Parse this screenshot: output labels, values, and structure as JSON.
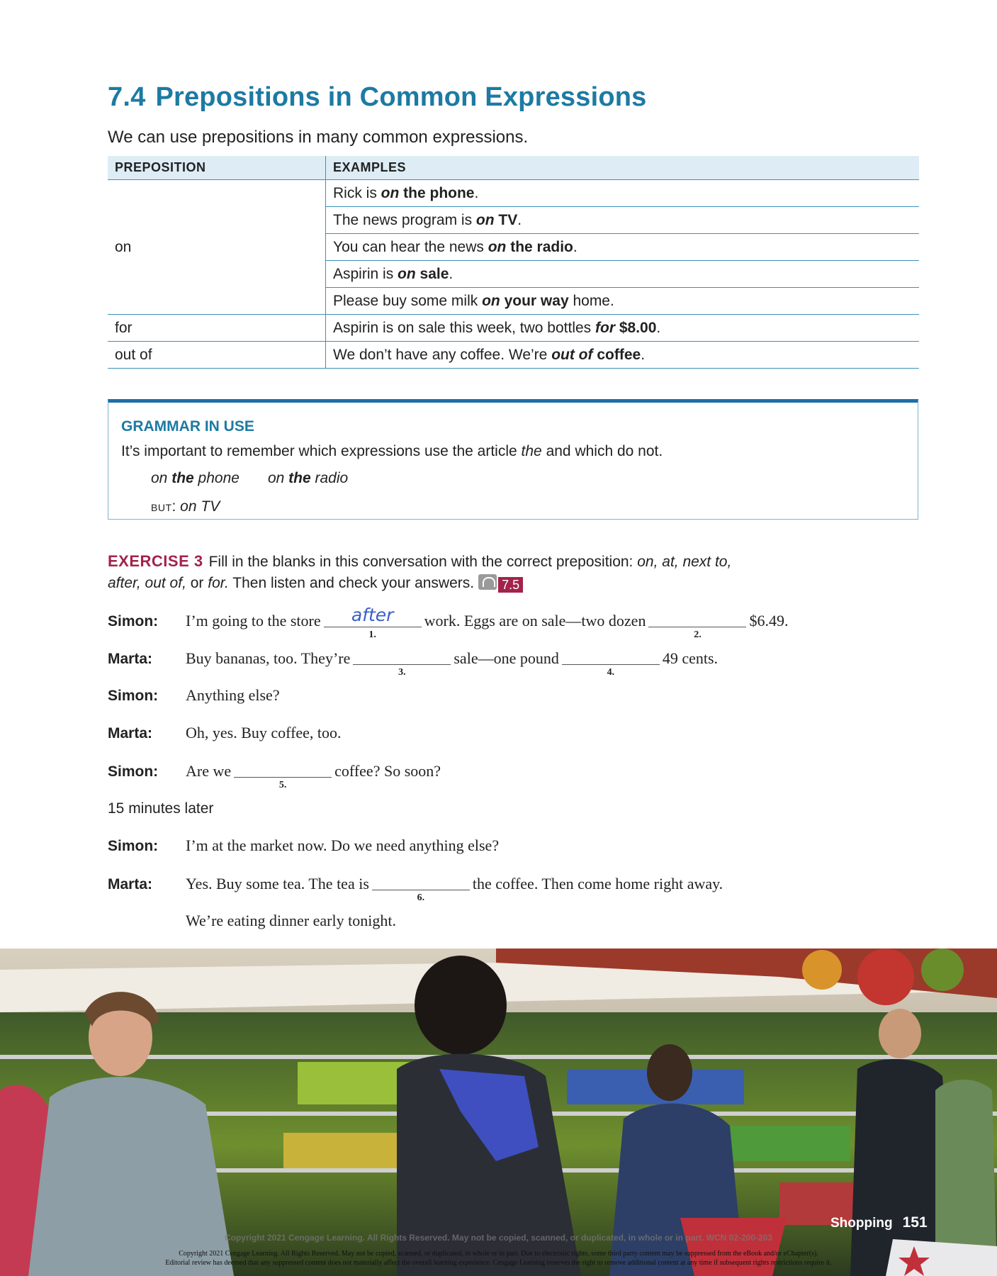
{
  "section": {
    "number": "7.4",
    "title": "Prepositions in Common Expressions"
  },
  "intro": "We can use prepositions in many common expressions.",
  "table": {
    "headers": [
      "PREPOSITION",
      "EXAMPLES"
    ],
    "groups": [
      {
        "preposition": "on",
        "examples": [
          [
            [
              "Rick is ",
              ""
            ],
            [
              "on",
              "bi"
            ],
            [
              " the phone",
              "b"
            ],
            [
              ".",
              ""
            ]
          ],
          [
            [
              "The news program is ",
              ""
            ],
            [
              "on",
              "bi"
            ],
            [
              " TV",
              "b"
            ],
            [
              ".",
              ""
            ]
          ],
          [
            [
              "You can hear the news ",
              ""
            ],
            [
              "on",
              "bi"
            ],
            [
              " the radio",
              "b"
            ],
            [
              ".",
              ""
            ]
          ],
          [
            [
              "Aspirin is ",
              ""
            ],
            [
              "on",
              "bi"
            ],
            [
              " sale",
              "b"
            ],
            [
              ".",
              ""
            ]
          ],
          [
            [
              "Please buy some milk ",
              ""
            ],
            [
              "on",
              "bi"
            ],
            [
              " your way",
              "b"
            ],
            [
              " home.",
              ""
            ]
          ]
        ]
      },
      {
        "preposition": "for",
        "examples": [
          [
            [
              "Aspirin is on sale this week, two bottles ",
              ""
            ],
            [
              "for",
              "bi"
            ],
            [
              " $8.00",
              "b"
            ],
            [
              ".",
              ""
            ]
          ]
        ]
      },
      {
        "preposition": "out of",
        "examples": [
          [
            [
              "We don’t have any coffee. We’re ",
              ""
            ],
            [
              "out of",
              "bi"
            ],
            [
              " coffee",
              "b"
            ],
            [
              ".",
              ""
            ]
          ]
        ]
      }
    ]
  },
  "grammar_in_use": {
    "title": "GRAMMAR IN USE",
    "text_before": "It’s important to remember which expressions use the article ",
    "text_italic": "the",
    "text_after": " and which do not.",
    "example1_a": "on ",
    "example1_b": "the",
    "example1_c": " phone",
    "example2_a": "on ",
    "example2_b": "the",
    "example2_c": " radio",
    "but_label": "BUT",
    "but_example": "on TV"
  },
  "exercise": {
    "label": "EXERCISE 3",
    "instruction_1": "Fill in the blanks in this conversation with the correct preposition: ",
    "options_1": "on, at, next to,",
    "options_2": "after, out of,",
    "instruction_2": " or ",
    "option_last": "for.",
    "instruction_3": " Then listen and check your answers.",
    "audio_track": "7.5"
  },
  "dialogue": [
    {
      "speaker": "Simon:",
      "parts": [
        {
          "t": "I’m going to the store"
        },
        {
          "blank": "1.",
          "answer": "after"
        },
        {
          "t": "work. Eggs are on sale—two dozen"
        },
        {
          "blank": "2.",
          "answer": ""
        },
        {
          "t": "$6.49."
        }
      ]
    },
    {
      "speaker": "Marta:",
      "parts": [
        {
          "t": "Buy bananas, too. They’re"
        },
        {
          "blank": "3.",
          "answer": ""
        },
        {
          "t": "sale—one pound"
        },
        {
          "blank": "4.",
          "answer": ""
        },
        {
          "t": "49 cents."
        }
      ]
    },
    {
      "speaker": "Simon:",
      "parts": [
        {
          "t": "Anything else?"
        }
      ]
    },
    {
      "speaker": "Marta:",
      "parts": [
        {
          "t": "Oh, yes. Buy coffee, too."
        }
      ]
    },
    {
      "speaker": "Simon:",
      "parts": [
        {
          "t": "Are we"
        },
        {
          "blank": "5.",
          "answer": ""
        },
        {
          "t": "coffee? So soon?"
        }
      ]
    },
    {
      "plain": "15 minutes later"
    },
    {
      "speaker": "Simon:",
      "parts": [
        {
          "t": "I’m at the market now. Do we need anything else?"
        }
      ]
    },
    {
      "speaker": "Marta:",
      "parts": [
        {
          "t": "Yes. Buy some tea. The tea is"
        },
        {
          "blank": "6.",
          "answer": ""
        },
        {
          "t": "the coffee. Then come home right away."
        }
      ]
    },
    {
      "speaker": "",
      "parts": [
        {
          "t": "We’re eating dinner early tonight."
        }
      ]
    }
  ],
  "footer": {
    "chapter": "Shopping",
    "page": "151",
    "copyright_watermark": "Copyright 2021 Cengage Learning. All Rights Reserved. May not be copied, scanned, or duplicated, in whole or in part.  WCN 02-200-203",
    "copyright_line1": "Copyright 2021 Cengage Learning. All Rights Reserved. May not be copied, scanned, or duplicated, in whole or in part. Due to electronic rights, some third party content may be suppressed from the eBook and/or eChapter(s).",
    "copyright_line2": "Editorial review has deemed that any suppressed content does not materially affect the overall learning experience. Cengage Learning reserves the right to remove additional content at any time if subsequent rights restrictions require it."
  }
}
